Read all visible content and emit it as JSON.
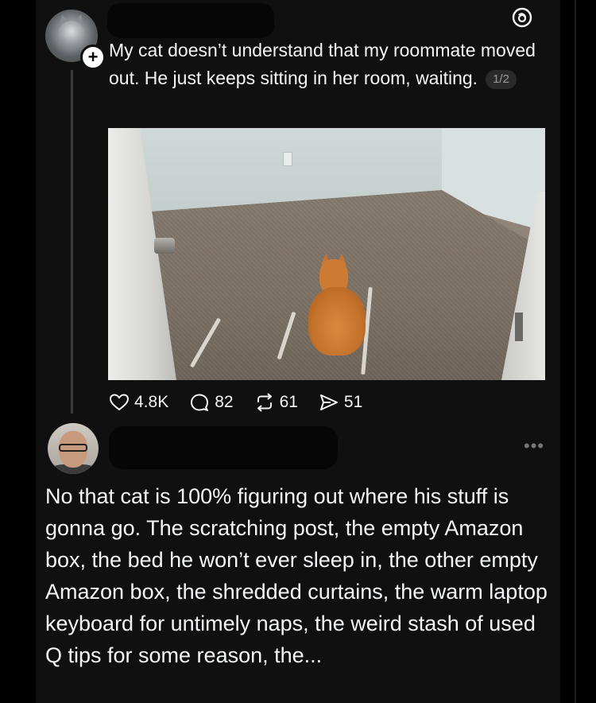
{
  "post": {
    "text": "My cat doesn’t understand that my roommate moved out. He just keeps sitting in her room, waiting.",
    "page_indicator": "1/2",
    "stats": {
      "likes": "4.8K",
      "replies": "82",
      "reposts": "61",
      "shares": "51"
    }
  },
  "reply": {
    "text": "No that cat is 100% figuring out where his stuff is gonna go. The scratching post, the empty Amazon box, the bed he won’t ever sleep in, the other empty Amazon box, the shredded curtains, the warm laptop keyboard for untimely naps, the weird stash of used Q tips for some reason, the...",
    "more_icon": "ellipsis-icon"
  },
  "icons": [
    "threads-icon",
    "heart-icon",
    "comment-icon",
    "repost-icon",
    "share-icon",
    "plus-icon"
  ]
}
